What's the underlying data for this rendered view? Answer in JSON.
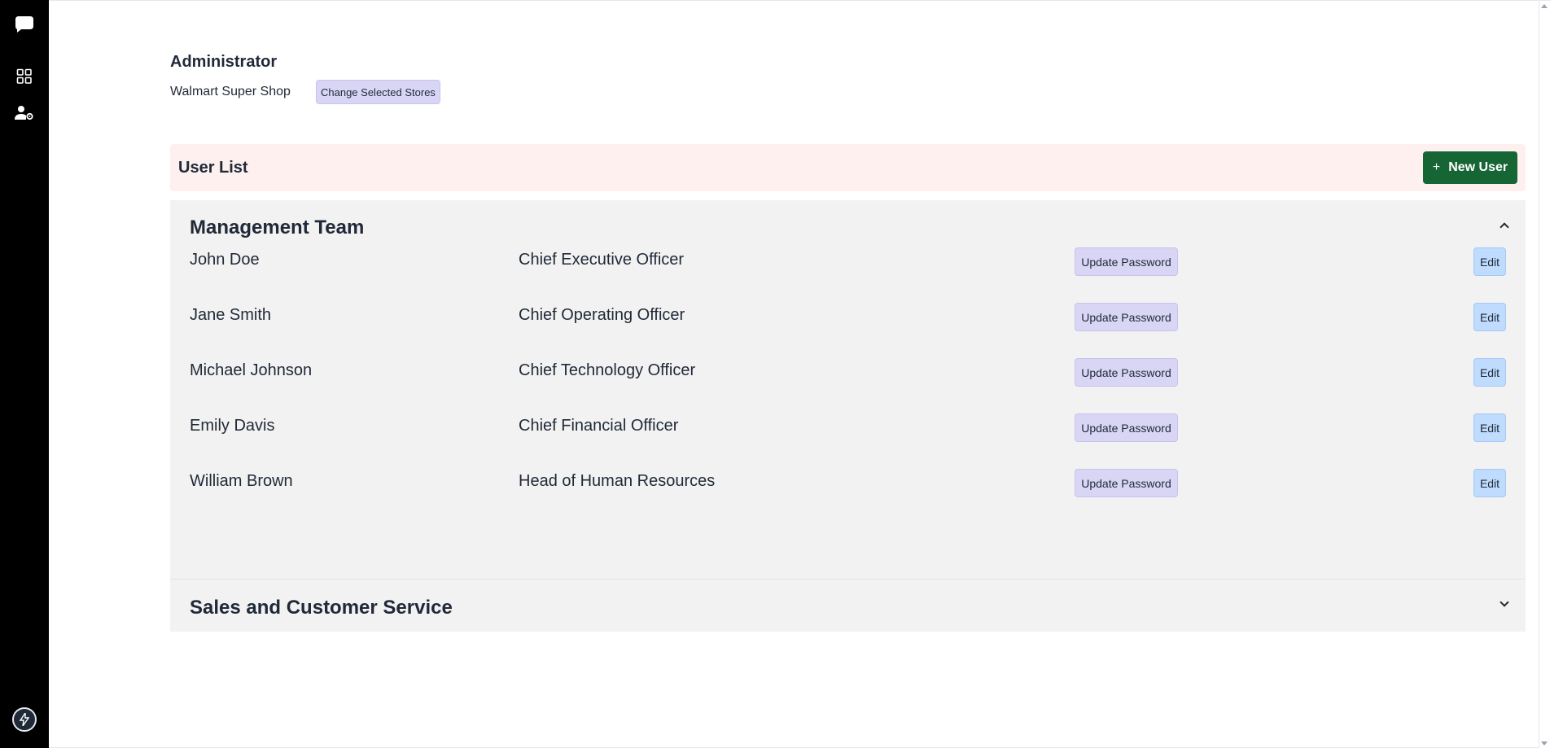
{
  "sidebar": {
    "icons": [
      "chat-bubble-icon",
      "dashboard-icon",
      "user-settings-icon",
      "bolt-avatar-icon"
    ]
  },
  "header": {
    "role_title": "Administrator",
    "store_name": "Walmart Super Shop",
    "change_stores_label": "Change Selected Stores"
  },
  "user_list": {
    "title": "User List",
    "new_user_label": "New User"
  },
  "sections": [
    {
      "title": "Management Team",
      "expanded": true,
      "users": [
        {
          "name": "John Doe",
          "role": "Chief Executive Officer",
          "update_label": "Update Password",
          "edit_label": "Edit"
        },
        {
          "name": "Jane Smith",
          "role": "Chief Operating Officer",
          "update_label": "Update Password",
          "edit_label": "Edit"
        },
        {
          "name": "Michael Johnson",
          "role": "Chief Technology Officer",
          "update_label": "Update Password",
          "edit_label": "Edit"
        },
        {
          "name": "Emily Davis",
          "role": "Chief Financial Officer",
          "update_label": "Update Password",
          "edit_label": "Edit"
        },
        {
          "name": "William Brown",
          "role": "Head of Human Resources",
          "update_label": "Update Password",
          "edit_label": "Edit"
        }
      ]
    },
    {
      "title": "Sales and Customer Service",
      "expanded": false,
      "users": []
    }
  ],
  "colors": {
    "sidebar": "#000000",
    "new_user_button": "#166534",
    "user_list_bar": "#fdf0ef",
    "lavender_button": "#d9d6f5",
    "edit_button": "#bfdbfe",
    "accordion_bg": "#f2f2f2"
  }
}
